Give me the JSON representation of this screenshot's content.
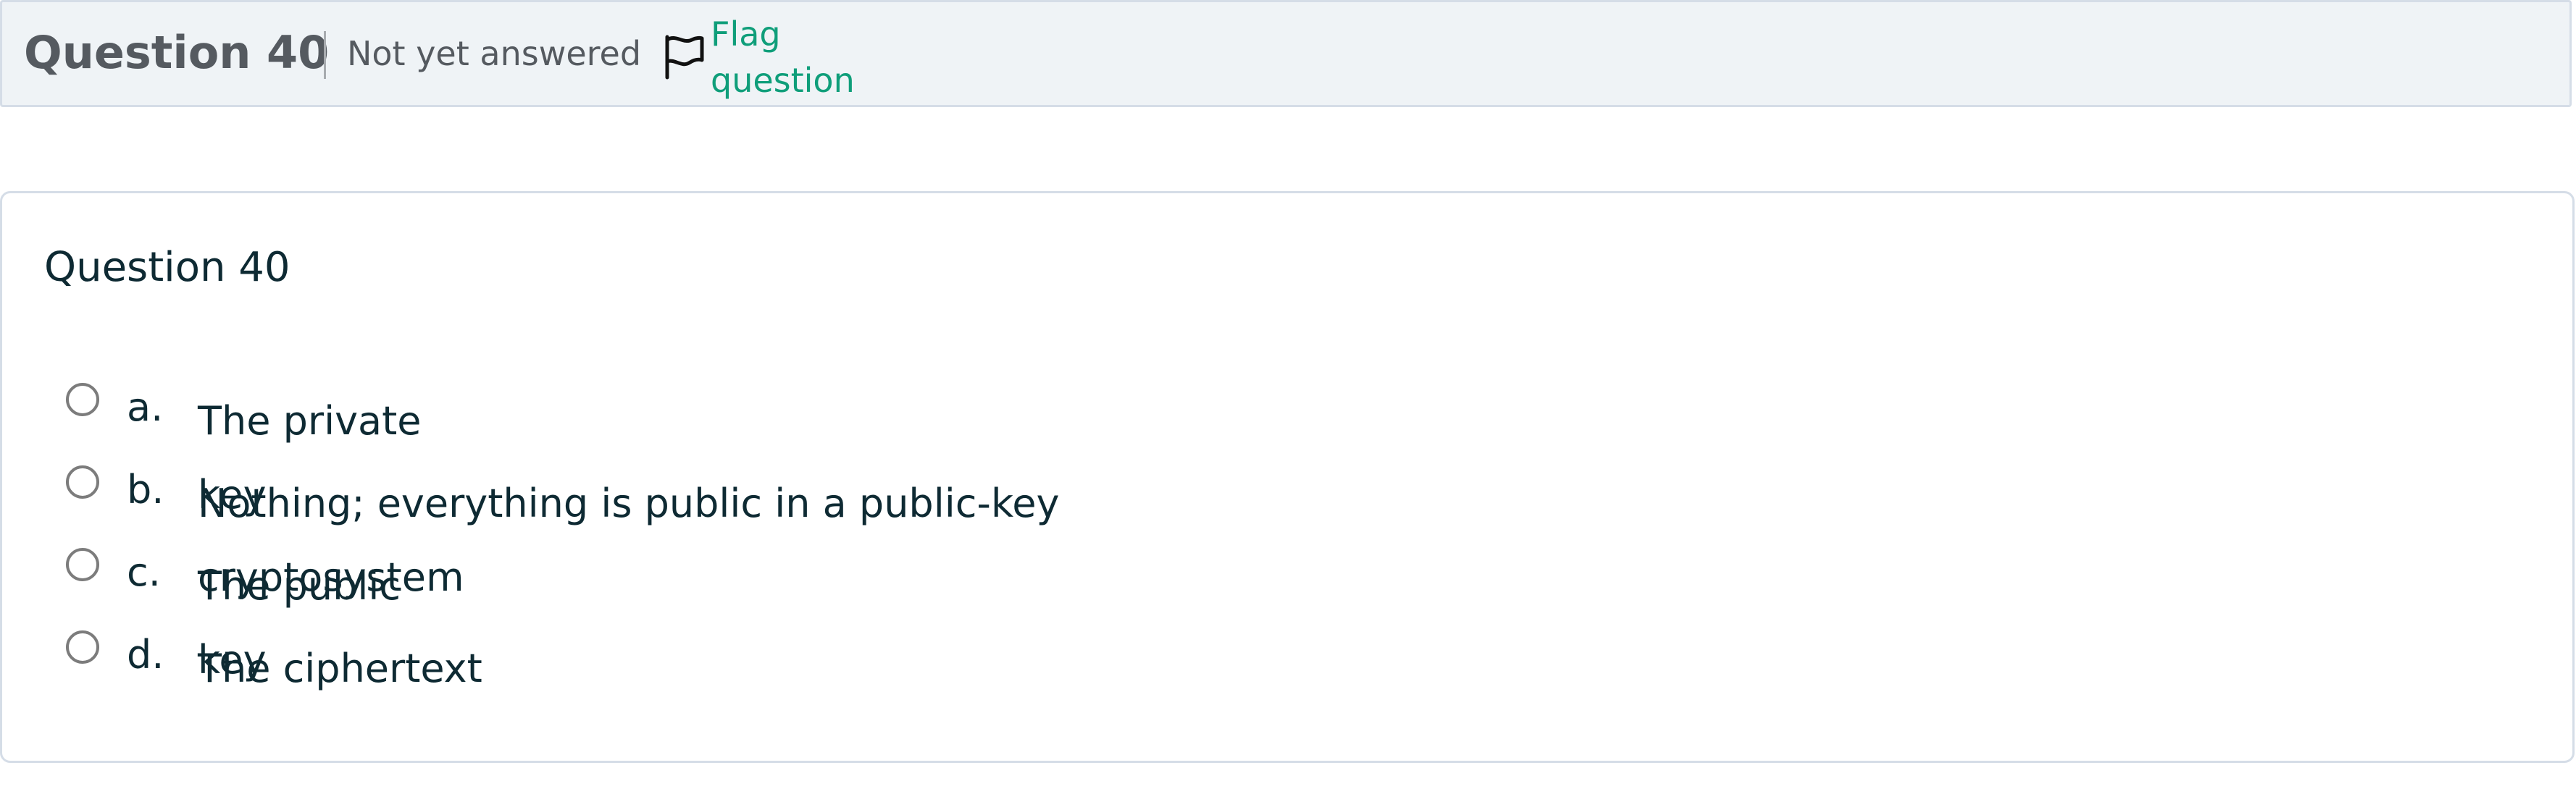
{
  "header": {
    "title": "Question 40",
    "state": "Not yet answered",
    "flag_label": "Flag question",
    "flag_icon": "flag-outline-icon",
    "flag_color": "#0f9e7a"
  },
  "question": {
    "text": "Question 40",
    "options": [
      {
        "letter": "a.",
        "label": "The private key"
      },
      {
        "letter": "b.",
        "label": "Nothing; everything is public in a public-key cryptosystem"
      },
      {
        "letter": "c.",
        "label": "The public key"
      },
      {
        "letter": "d.",
        "label": "The ciphertext"
      }
    ]
  }
}
